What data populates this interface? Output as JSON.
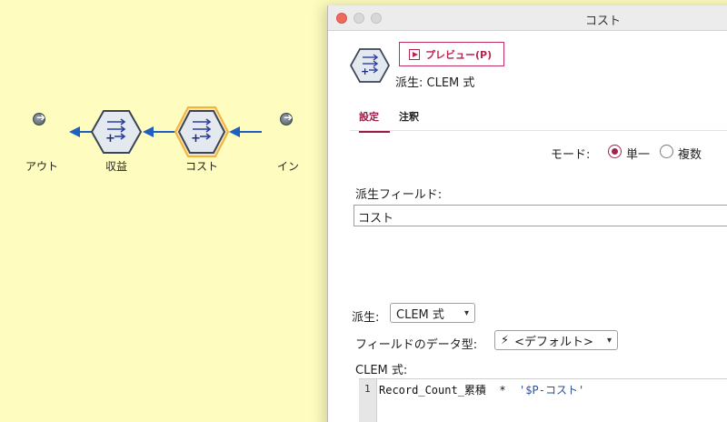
{
  "canvas": {
    "nodes": [
      {
        "label": "アウト"
      },
      {
        "label": "収益"
      },
      {
        "label": "コスト"
      },
      {
        "label": "イン"
      }
    ]
  },
  "dialog": {
    "window_title": "コスト",
    "preview_button": "プレビュー(P)",
    "node_type_subtitle": "派生: CLEM 式",
    "tabs": [
      {
        "label": "設定",
        "active": true
      },
      {
        "label": "注釈",
        "active": false
      }
    ],
    "mode": {
      "label": "モード:",
      "options": [
        {
          "label": "単一",
          "selected": true
        },
        {
          "label": "複数",
          "selected": false
        }
      ]
    },
    "derive_field": {
      "label": "派生フィールド:",
      "value": "コスト"
    },
    "derive_as": {
      "label": "派生:",
      "value": "CLEM 式"
    },
    "field_type": {
      "label": "フィールドのデータ型:",
      "value": "<デフォルト>"
    },
    "expression": {
      "label": "CLEM 式:",
      "line_number": "1",
      "code_plain": "Record_Count_累積  *  ",
      "code_string": "'$P-コスト'"
    }
  },
  "colors": {
    "canvas_bg": "#fefdbf",
    "accent": "#9b1d44",
    "arrow": "#1f5fc0",
    "selected_node_ring": "#f2b33d"
  }
}
